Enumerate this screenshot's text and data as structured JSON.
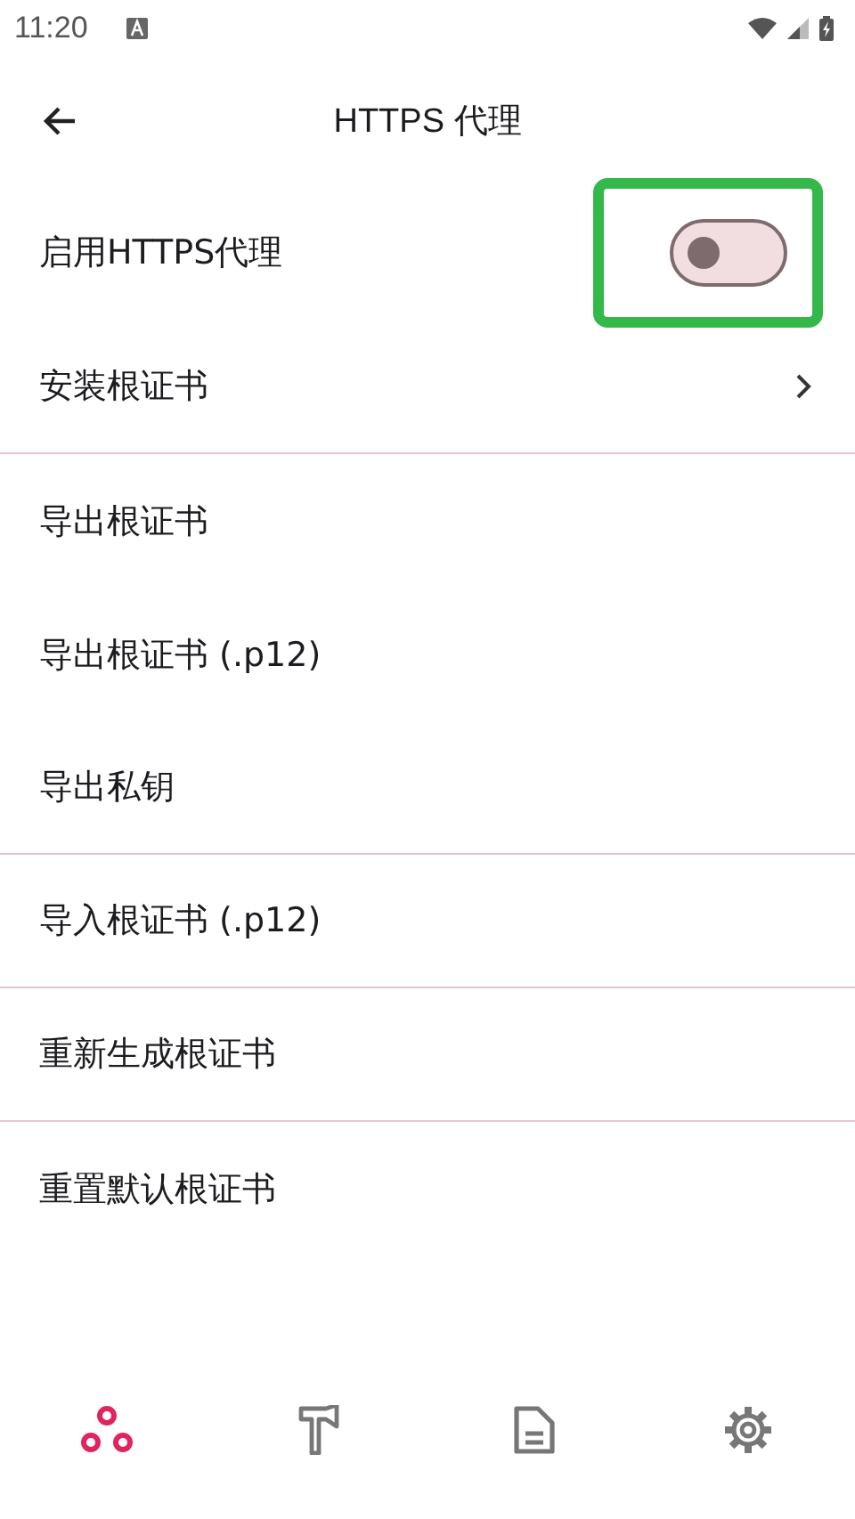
{
  "status_bar": {
    "time": "11:20"
  },
  "app_bar": {
    "title": "HTTPS 代理"
  },
  "rows": [
    {
      "kind": "toggle",
      "label": "启用HTTPS代理",
      "on": false,
      "highlighted": true,
      "divider_after": false
    },
    {
      "kind": "link",
      "label": "安装根证书",
      "divider_after": true
    },
    {
      "kind": "action",
      "label": "导出根证书",
      "divider_after": false
    },
    {
      "kind": "action",
      "label": "导出根证书 (.p12)",
      "divider_after": false
    },
    {
      "kind": "action",
      "label": "导出私钥",
      "divider_after": true
    },
    {
      "kind": "action",
      "label": "导入根证书 (.p12)",
      "divider_after": true
    },
    {
      "kind": "action",
      "label": "重新生成根证书",
      "divider_after": true
    },
    {
      "kind": "action",
      "label": "重置默认根证书",
      "divider_after": false
    }
  ],
  "bottom_nav": [
    {
      "kind": "nodes",
      "selected": true
    },
    {
      "kind": "hammer",
      "selected": false
    },
    {
      "kind": "document",
      "selected": false
    },
    {
      "kind": "settings",
      "selected": false
    }
  ]
}
